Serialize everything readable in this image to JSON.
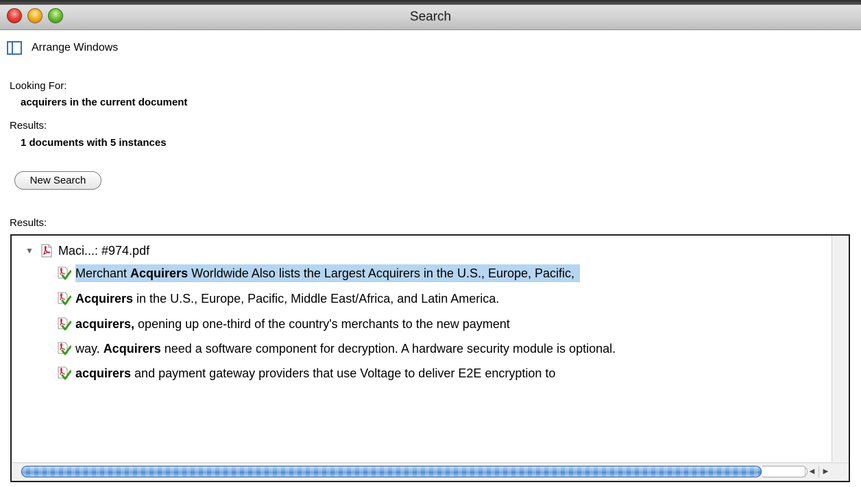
{
  "window": {
    "title": "Search"
  },
  "toolbar": {
    "arrange_label": "Arrange Windows"
  },
  "criteria": {
    "looking_for_label": "Looking For:",
    "looking_for_value": "acquirers in the current document",
    "results_label": "Results:",
    "results_value": "1 documents with 5 instances"
  },
  "new_search_label": "New Search",
  "results_list_label": "Results:",
  "tree": {
    "document": "Maci...: #974.pdf",
    "hits": [
      {
        "before": "Merchant ",
        "match": "Acquirers",
        "after": " Worldwide Also lists the Largest Acquirers in the U.S., Europe, Pacific,"
      },
      {
        "before": "",
        "match": "Acquirers",
        "after": " in the U.S., Europe, Pacific, Middle East/Africa, and Latin America."
      },
      {
        "before": "",
        "match": "acquirers,",
        "after": " opening up one-third of the country's merchants to the new payment"
      },
      {
        "before": "way. ",
        "match": "Acquirers",
        "after": " need a software component for decryption. A hardware security module is optional."
      },
      {
        "before": "",
        "match": "acquirers",
        "after": " and payment gateway providers that use Voltage to deliver E2E encryption to"
      }
    ]
  },
  "colors": {
    "selection": "#b5d5f1",
    "accent": "#3a6fb8"
  }
}
